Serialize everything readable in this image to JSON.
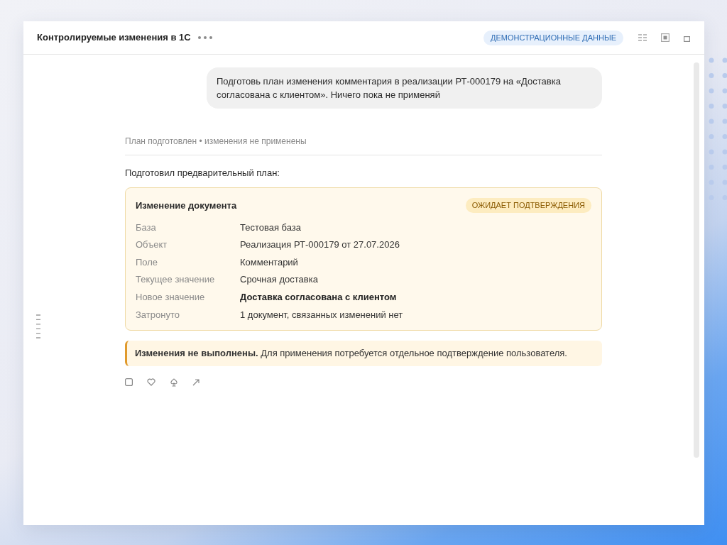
{
  "window": {
    "title": "Контролируемые изменения в 1С",
    "badge": "ДЕМОНСТРАЦИОННЫЕ ДАННЫЕ"
  },
  "chat": {
    "user_message": "Подготовь план изменения комментария в реализации РТ-000179 на «Доставка согласована с клиентом». Ничего пока не применяй",
    "status": "План подготовлен • изменения не применены",
    "intro": "Подготовил предварительный план:",
    "plan_card": {
      "title": "Изменение документа",
      "badge": "ОЖИДАЕТ ПОДТВЕРЖДЕНИЯ",
      "rows": [
        {
          "label": "База",
          "value": "Тестовая база",
          "emphasis": false
        },
        {
          "label": "Объект",
          "value": "Реализация РТ-000179 от 27.07.2026",
          "emphasis": false
        },
        {
          "label": "Поле",
          "value": "Комментарий",
          "emphasis": false
        },
        {
          "label": "Текущее значение",
          "value": "Срочная доставка",
          "emphasis": false
        },
        {
          "label": "Новое значение",
          "value": "Доставка согласована с клиентом",
          "emphasis": true
        },
        {
          "label": "Затронуто",
          "value": "1 документ, связанных изменений нет",
          "emphasis": false
        }
      ]
    },
    "notice": "**Изменения не выполнены.** Для применения потребуется отдельное подтверждение пользователя."
  }
}
